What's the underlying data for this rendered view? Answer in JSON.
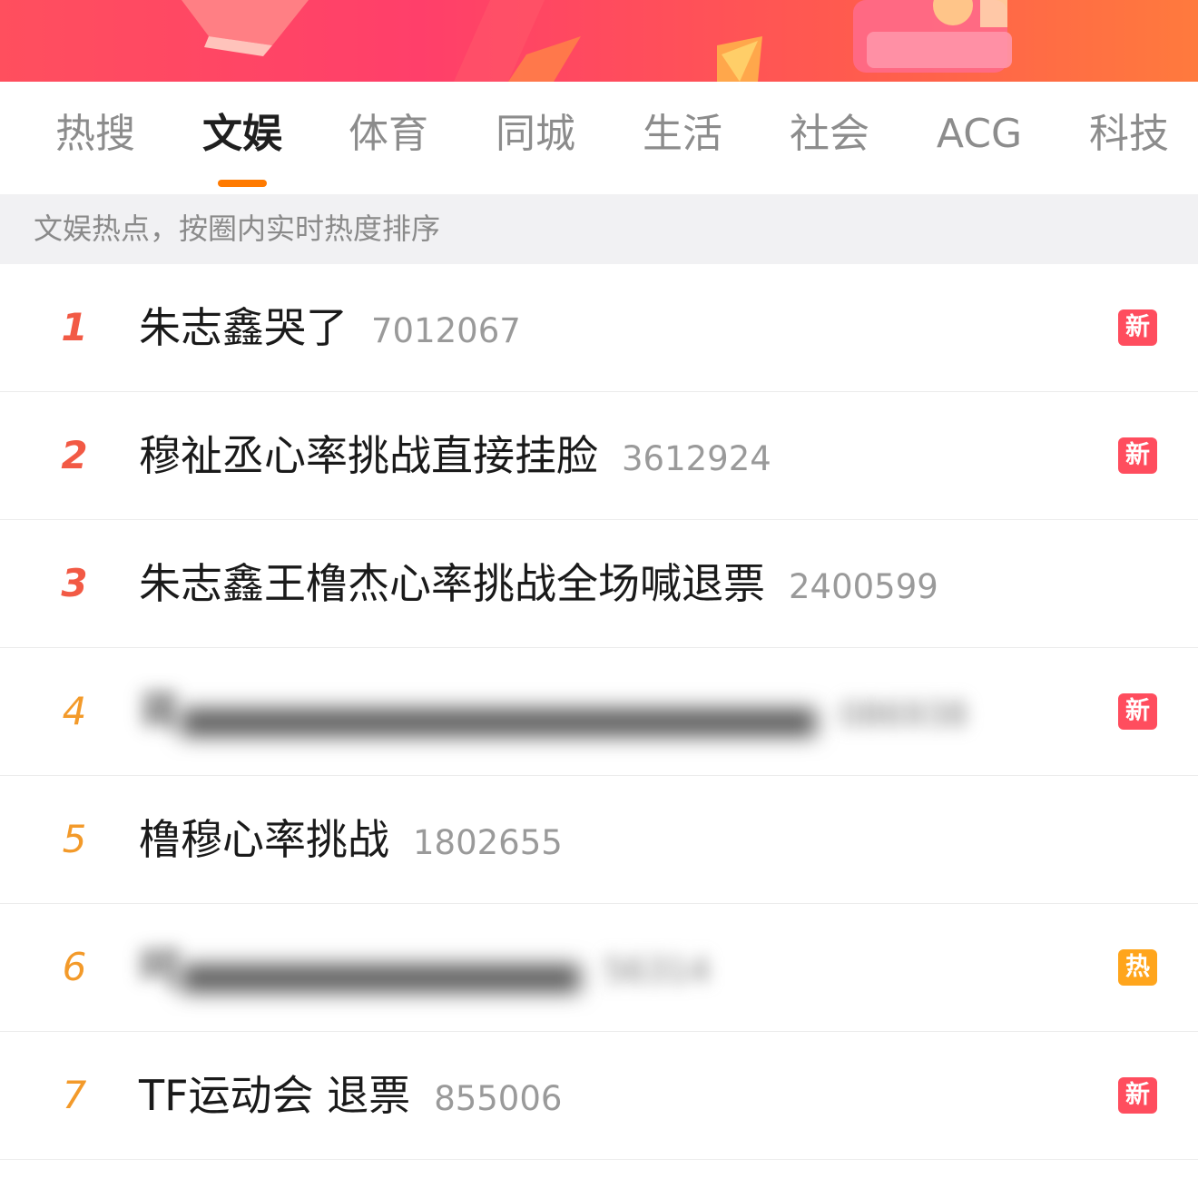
{
  "colors": {
    "accent_orange": "#ff7a00",
    "rank_top": "#f25a45",
    "rank_rest": "#f39a2a",
    "badge_new": "#ff4d5e",
    "badge_hot": "#ffa51c"
  },
  "tabs": [
    {
      "label": "热搜",
      "active": false
    },
    {
      "label": "文娱",
      "active": true
    },
    {
      "label": "体育",
      "active": false
    },
    {
      "label": "同城",
      "active": false
    },
    {
      "label": "生活",
      "active": false
    },
    {
      "label": "社会",
      "active": false
    },
    {
      "label": "ACG",
      "active": false
    },
    {
      "label": "科技",
      "active": false
    }
  ],
  "subtitle": "文娱热点，按圈内实时热度排序",
  "items": [
    {
      "rank": "1",
      "title": "朱志鑫哭了",
      "heat": "7012067",
      "badge": "新",
      "badge_type": "new",
      "blurred": false
    },
    {
      "rank": "2",
      "title": "穆祉丞心率挑战直接挂脸",
      "heat": "3612924",
      "badge": "新",
      "badge_type": "new",
      "blurred": false
    },
    {
      "rank": "3",
      "title": "朱志鑫王橹杰心率挑战全场喊退票",
      "heat": "2400599",
      "badge": "",
      "badge_type": "",
      "blurred": false
    },
    {
      "rank": "4",
      "title": "蒋",
      "heat": "086938",
      "badge": "新",
      "badge_type": "new",
      "blurred": true
    },
    {
      "rank": "5",
      "title": "橹穆心率挑战",
      "heat": "1802655",
      "badge": "",
      "badge_type": "",
      "blurred": false
    },
    {
      "rank": "6",
      "title": "呵",
      "heat": "56314",
      "badge": "热",
      "badge_type": "hot",
      "blurred": true
    },
    {
      "rank": "7",
      "title": "TF运动会 退票",
      "heat": "855006",
      "badge": "新",
      "badge_type": "new",
      "blurred": false
    }
  ]
}
